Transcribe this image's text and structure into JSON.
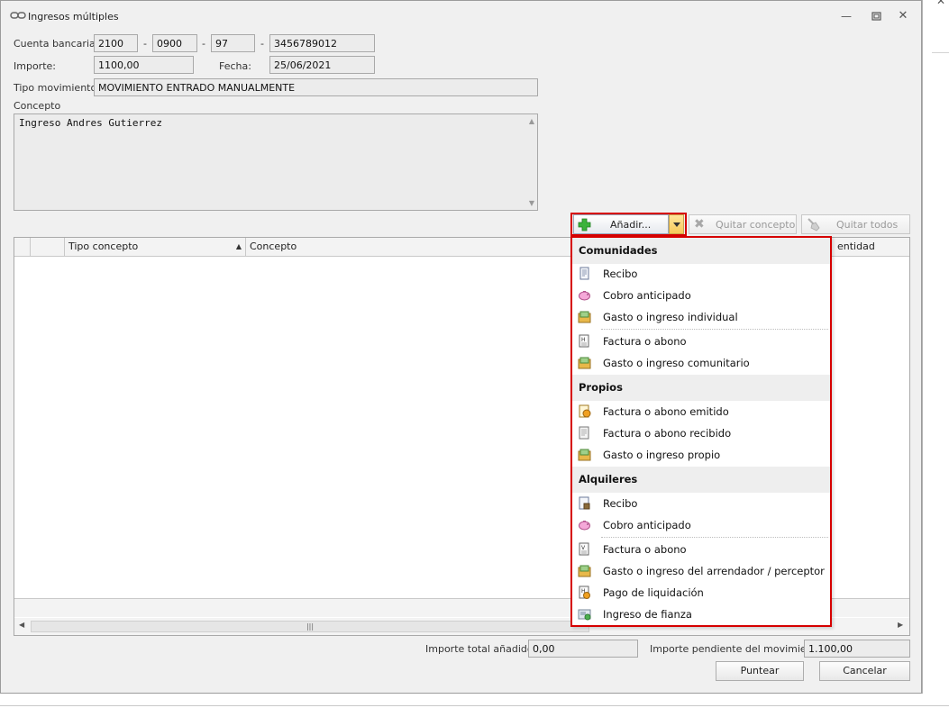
{
  "window": {
    "title": "Ingresos múltiples"
  },
  "form": {
    "cuenta_label": "Cuenta bancaria:",
    "cuenta_entidad": "2100",
    "cuenta_oficina": "0900",
    "cuenta_dc": "97",
    "cuenta_numero": "3456789012",
    "dash": "-",
    "importe_label": "Importe:",
    "importe_value": "1100,00",
    "fecha_label": "Fecha:",
    "fecha_value": "25/06/2021",
    "tipo_label": "Tipo movimiento:",
    "tipo_value": "MOVIMIENTO ENTRADO MANUALMENTE",
    "concepto_label": "Concepto",
    "concepto_value": "Ingreso Andres Gutierrez"
  },
  "toolbar": {
    "add_label": "Añadir...",
    "quitar_label": "Quitar concepto",
    "quitar_todos_label": "Quitar todos"
  },
  "grid": {
    "columns": [
      "Tipo concepto",
      "Concepto",
      "entidad"
    ]
  },
  "footer": {
    "total_label": "Importe total añadido:",
    "total_value": "0,00",
    "pendiente_label": "Importe pendiente del movimiento:",
    "pendiente_value": "1.100,00",
    "puntear_label": "Puntear",
    "cancelar_label": "Cancelar"
  },
  "menu": {
    "groups": [
      {
        "title": "Comunidades",
        "items": [
          "Recibo",
          "Cobro anticipado",
          "Gasto o ingreso individual",
          "Factura o abono",
          "Gasto o ingreso comunitario"
        ]
      },
      {
        "title": "Propios",
        "items": [
          "Factura o abono emitido",
          "Factura o abono recibido",
          "Gasto o ingreso propio"
        ]
      },
      {
        "title": "Alquileres",
        "items": [
          "Recibo",
          "Cobro anticipado",
          "Factura o abono",
          "Gasto o ingreso del arrendador / perceptor",
          "Pago de liquidación",
          "Ingreso de fianza"
        ]
      }
    ]
  }
}
